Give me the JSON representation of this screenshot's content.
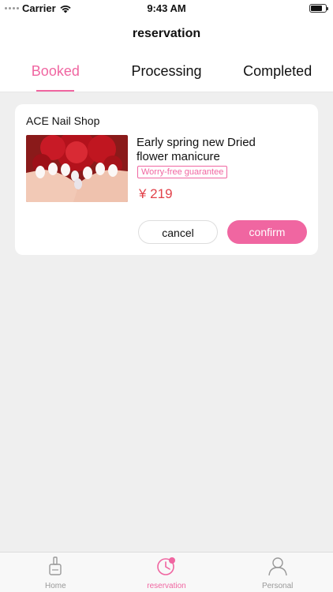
{
  "status_bar": {
    "carrier": "Carrier",
    "time": "9:43 AM"
  },
  "nav": {
    "title": "reservation"
  },
  "tabs": [
    {
      "label": "Booked",
      "active": true
    },
    {
      "label": "Processing",
      "active": false
    },
    {
      "label": "Completed",
      "active": false
    }
  ],
  "order": {
    "shop_name": "ACE Nail Shop",
    "title": "Early spring new Dried flower manicure",
    "tag": "Worry-free guarantee",
    "price": "¥ 219",
    "cancel_label": "cancel",
    "confirm_label": "confirm"
  },
  "tabbar": [
    {
      "label": "Home",
      "icon": "nail-polish-icon",
      "active": false
    },
    {
      "label": "reservation",
      "icon": "clock-icon",
      "active": true
    },
    {
      "label": "Personal",
      "icon": "person-icon",
      "active": false
    }
  ],
  "colors": {
    "accent": "#f066a1",
    "price": "#e2424a",
    "background": "#efefef"
  }
}
